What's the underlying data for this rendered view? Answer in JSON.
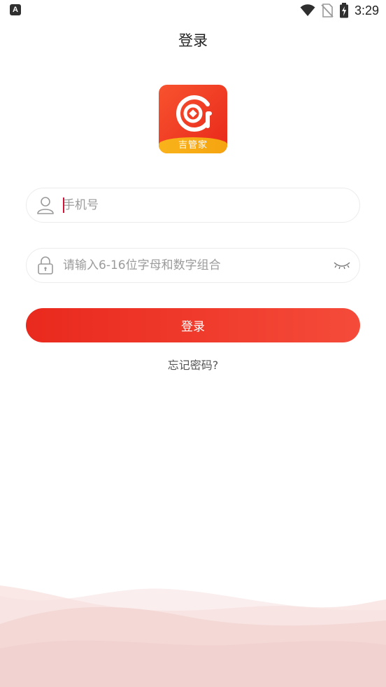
{
  "status_bar": {
    "left_badge": "A",
    "time": "3:29"
  },
  "header": {
    "title": "登录"
  },
  "logo": {
    "caption": "吉管家"
  },
  "form": {
    "phone": {
      "value": "",
      "placeholder": "手机号"
    },
    "password": {
      "value": "",
      "placeholder": "请输入6-16位字母和数字组合"
    },
    "login_label": "登录",
    "forgot_label": "忘记密码?"
  },
  "colors": {
    "accent": "#e9291d",
    "accent_end": "#f54b3a",
    "logo_band": "#f9b31b",
    "caret": "#d2143a"
  }
}
